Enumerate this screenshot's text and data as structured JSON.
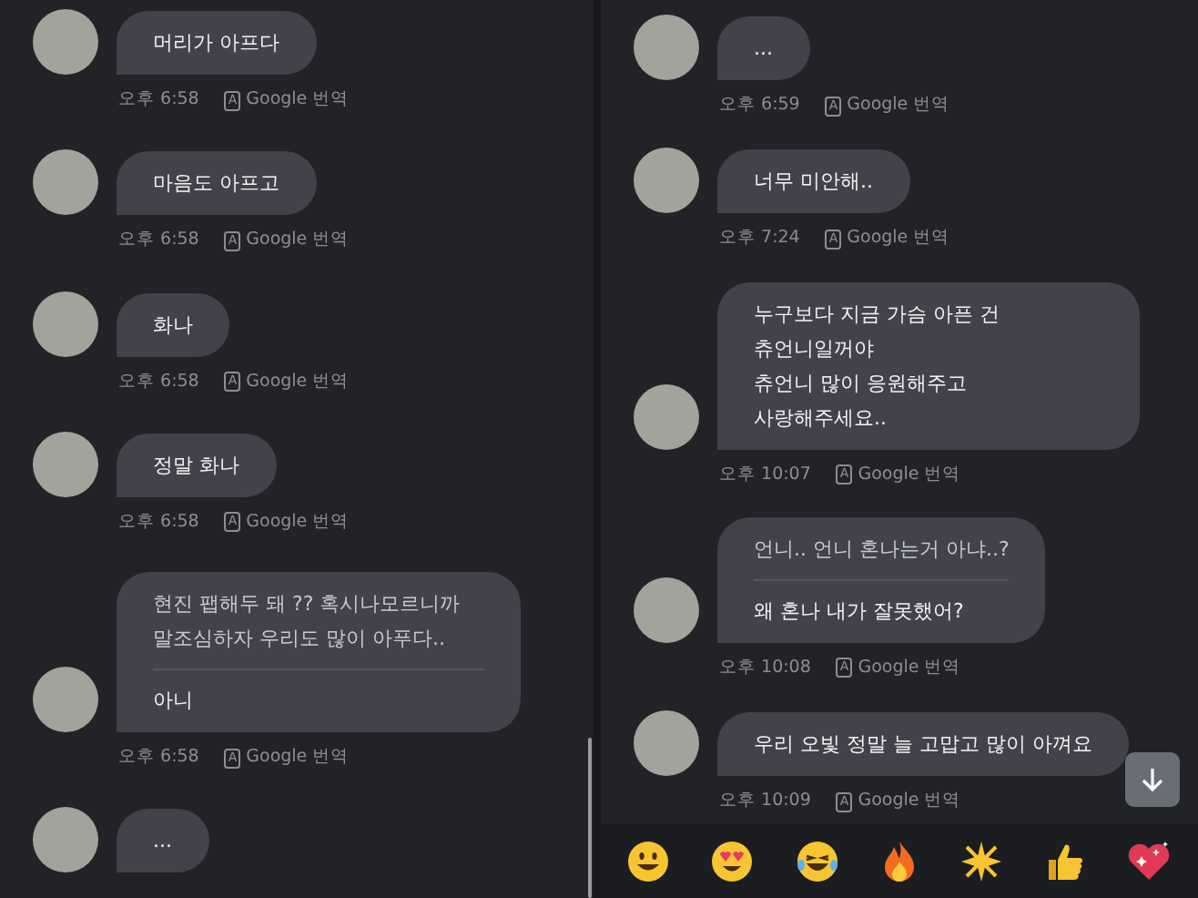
{
  "panels": [
    {
      "scrollbar": true,
      "messages": [
        {
          "parts": [
            {
              "kind": "main",
              "text": "머리가 아프다"
            }
          ],
          "time": "오후 6:58",
          "translate_badge": "A",
          "translate_label": "Google 번역"
        },
        {
          "parts": [
            {
              "kind": "main",
              "text": "마음도 아프고"
            }
          ],
          "time": "오후 6:58",
          "translate_badge": "A",
          "translate_label": "Google 번역"
        },
        {
          "parts": [
            {
              "kind": "main",
              "text": "화나"
            }
          ],
          "time": "오후 6:58",
          "translate_badge": "A",
          "translate_label": "Google 번역"
        },
        {
          "parts": [
            {
              "kind": "main",
              "text": "정말 화나"
            }
          ],
          "time": "오후 6:58",
          "translate_badge": "A",
          "translate_label": "Google 번역"
        },
        {
          "parts": [
            {
              "kind": "quote",
              "text": "현진 팹해두 돼 ?? 혹시나모르니까 말조심하자 우리도 많이 아푸다.."
            },
            {
              "kind": "main",
              "text": "아니"
            }
          ],
          "time": "오후 6:58",
          "translate_badge": "A",
          "translate_label": "Google 번역"
        },
        {
          "parts": [
            {
              "kind": "main",
              "text": "..."
            }
          ]
        }
      ]
    },
    {
      "scroll_down_button": true,
      "messages": [
        {
          "parts": [
            {
              "kind": "main",
              "text": "..."
            }
          ],
          "time": "오후 6:59",
          "translate_badge": "A",
          "translate_label": "Google 번역"
        },
        {
          "parts": [
            {
              "kind": "main",
              "text": "너무 미안해.."
            }
          ],
          "time": "오후 7:24",
          "translate_badge": "A",
          "translate_label": "Google 번역"
        },
        {
          "parts": [
            {
              "kind": "main",
              "text": "누구보다 지금 가슴 아픈 건 츄언니일꺼야"
            },
            {
              "kind": "main",
              "text": "츄언니 많이 응원해주고 사랑해주세요.."
            }
          ],
          "time": "오후 10:07",
          "translate_badge": "A",
          "translate_label": "Google 번역"
        },
        {
          "parts": [
            {
              "kind": "quote",
              "text": "언니.. 언니 혼나는거 아냐..?"
            },
            {
              "kind": "main",
              "text": "왜 혼나 내가 잘못했어?"
            }
          ],
          "time": "오후 10:08",
          "translate_badge": "A",
          "translate_label": "Google 번역"
        },
        {
          "parts": [
            {
              "kind": "main",
              "text": "우리 오빛 정말 늘 고맙고 많이 아껴요"
            }
          ],
          "time": "오후 10:09",
          "translate_badge": "A",
          "translate_label": "Google 번역"
        }
      ],
      "reaction_bar": true
    }
  ]
}
